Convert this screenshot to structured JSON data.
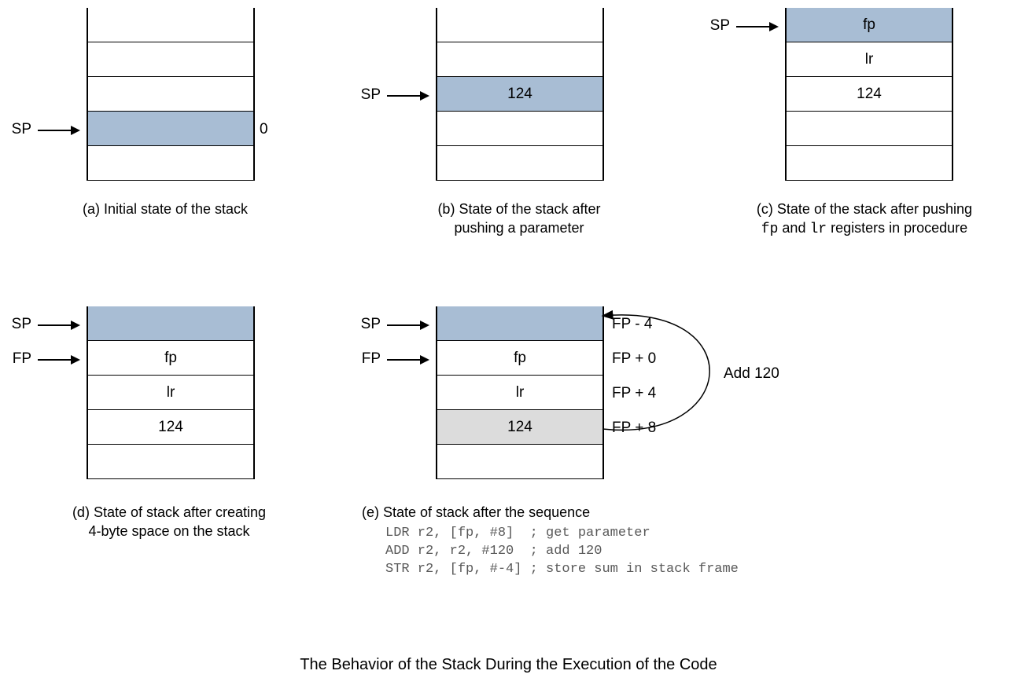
{
  "a": {
    "caption": "(a) Initial state of the stack",
    "cells": [
      "",
      "",
      "",
      "",
      ""
    ],
    "sp_label": "SP",
    "side_zero": "0"
  },
  "b": {
    "caption_l1": "(b) State of the stack after",
    "caption_l2": "pushing a parameter",
    "cells": [
      "",
      "",
      "124",
      "",
      ""
    ],
    "sp_label": "SP"
  },
  "c": {
    "caption_l1": "(c) State of the stack after pushing",
    "caption_l2_pre": "",
    "caption_l2_fp": "fp",
    "caption_l2_mid": " and ",
    "caption_l2_lr": "lr",
    "caption_l2_post": " registers in procedure",
    "cells": [
      "fp",
      "lr",
      "124",
      "",
      ""
    ],
    "sp_label": "SP"
  },
  "d": {
    "caption_l1": "(d) State of stack after creating",
    "caption_l2": "4-byte space on the stack",
    "cells": [
      "",
      "fp",
      "lr",
      "124",
      ""
    ],
    "sp_label": "SP",
    "fp_label": "FP"
  },
  "e": {
    "caption": "(e) State of stack after the sequence",
    "code_l1": "LDR r2, [fp, #8]  ; get parameter",
    "code_l2": "ADD r2, r2, #120  ; add 120",
    "code_l3": "STR r2, [fp, #-4] ; store sum in stack frame",
    "cells": [
      "",
      "fp",
      "lr",
      "124",
      ""
    ],
    "sp_label": "SP",
    "fp_label": "FP",
    "off0": "FP - 4",
    "off1": "FP + 0",
    "off2": "FP + 4",
    "off3": "FP + 8",
    "add_label": "Add 120"
  },
  "title": "The Behavior of the Stack During the Execution of the Code",
  "chart_data": {
    "type": "table",
    "title": "The Behavior of the Stack During the Execution of the Code",
    "stacks": [
      {
        "id": "a",
        "caption": "Initial state of the stack",
        "pointers": [
          {
            "name": "SP",
            "row": 3
          }
        ],
        "rows": [
          {
            "content": "",
            "highlight": false
          },
          {
            "content": "",
            "highlight": false
          },
          {
            "content": "",
            "highlight": false
          },
          {
            "content": "",
            "highlight": true,
            "annotation_right": "0"
          },
          {
            "content": "",
            "highlight": false
          }
        ]
      },
      {
        "id": "b",
        "caption": "State of the stack after pushing a parameter",
        "pointers": [
          {
            "name": "SP",
            "row": 2
          }
        ],
        "rows": [
          {
            "content": "",
            "highlight": false
          },
          {
            "content": "",
            "highlight": false
          },
          {
            "content": "124",
            "highlight": true
          },
          {
            "content": "",
            "highlight": false
          },
          {
            "content": "",
            "highlight": false
          }
        ]
      },
      {
        "id": "c",
        "caption": "State of the stack after pushing fp and lr registers in procedure",
        "pointers": [
          {
            "name": "SP",
            "row": 0
          }
        ],
        "rows": [
          {
            "content": "fp",
            "highlight": true
          },
          {
            "content": "lr",
            "highlight": false
          },
          {
            "content": "124",
            "highlight": false
          },
          {
            "content": "",
            "highlight": false
          },
          {
            "content": "",
            "highlight": false
          }
        ]
      },
      {
        "id": "d",
        "caption": "State of stack after creating 4-byte space on the stack",
        "pointers": [
          {
            "name": "SP",
            "row": 0
          },
          {
            "name": "FP",
            "row": 1
          }
        ],
        "rows": [
          {
            "content": "",
            "highlight": true
          },
          {
            "content": "fp",
            "highlight": false
          },
          {
            "content": "lr",
            "highlight": false
          },
          {
            "content": "124",
            "highlight": false
          },
          {
            "content": "",
            "highlight": false
          }
        ]
      },
      {
        "id": "e",
        "caption": "State of stack after the sequence",
        "code": [
          "LDR r2, [fp, #8]  ; get parameter",
          "ADD r2, r2, #120  ; add 120",
          "STR r2, [fp, #-4] ; store sum in stack frame"
        ],
        "pointers": [
          {
            "name": "SP",
            "row": 0
          },
          {
            "name": "FP",
            "row": 1
          }
        ],
        "rows": [
          {
            "content": "",
            "highlight": true,
            "annotation_right": "FP - 4"
          },
          {
            "content": "fp",
            "highlight": false,
            "annotation_right": "FP + 0"
          },
          {
            "content": "lr",
            "highlight": false,
            "annotation_right": "FP + 4"
          },
          {
            "content": "124",
            "highlight": false,
            "grey": true,
            "annotation_right": "FP + 8"
          }
        ],
        "arc_annotation": "Add 120"
      }
    ]
  }
}
